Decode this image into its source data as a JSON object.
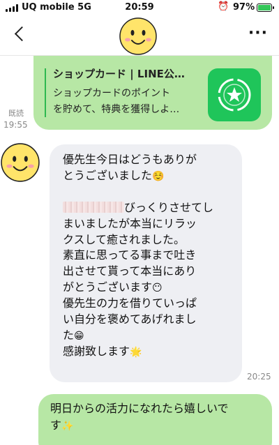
{
  "status_bar": {
    "carrier": "UQ mobile  5G",
    "time": "20:59",
    "alarm_icon": "⏰",
    "battery_percent": "97%"
  },
  "header": {
    "back_icon": "chevron-left-icon",
    "more_label": "···"
  },
  "messages": {
    "shop_card": {
      "title": "ショップカード | LINE公…",
      "desc_line1": "ショップカードのポイント",
      "desc_line2": "を貯めて、特典を獲得しよ…",
      "read": "既読",
      "time": "19:55"
    },
    "received": {
      "line1": "優先生今日はどうもありが",
      "line2": "とうございました",
      "emoji1": "☺️",
      "line4_suffix": "びっくりさせてし",
      "line5": "まいましたが本当にリラッ",
      "line6": "クスして癒されました。",
      "line7": "素直に思ってる事まで吐き",
      "line8": "出させて貰って本当にあり",
      "line9": "がとうございます",
      "emoji2": "😶",
      "line10": "優先生の力を借りていっぱ",
      "line11": "い自分を褒めてあげれまし",
      "line12": "た",
      "emoji3": "😁",
      "line13": "感謝致します",
      "emoji4": "🌟",
      "time": "20:25"
    },
    "sent": {
      "line1": "明日からの活力になれたら嬉しいで",
      "line2": "す",
      "emoji": "✨"
    }
  },
  "colors": {
    "sent_bubble": "#b7e7a5",
    "received_bubble": "#eeeff3",
    "line_green": "#1fc55a",
    "battery": "#35c759"
  }
}
